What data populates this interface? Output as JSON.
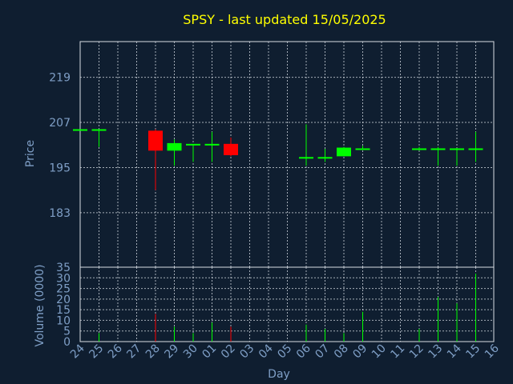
{
  "chart_data": {
    "type": "candlestick",
    "title": "SPSY - last updated 15/05/2025",
    "xlabel": "Day",
    "price_panel": {
      "ylabel": "Price",
      "ylim": [
        168.5,
        228.5
      ],
      "yticks": [
        183,
        195,
        207,
        219
      ]
    },
    "volume_panel": {
      "ylabel": "Volume (0000)",
      "ylim": [
        0,
        35
      ],
      "yticks": [
        0,
        5,
        10,
        15,
        20,
        25,
        30,
        35
      ]
    },
    "x_ticks": [
      "24",
      "25",
      "26",
      "27",
      "28",
      "29",
      "30",
      "01",
      "02",
      "03",
      "04",
      "05",
      "06",
      "07",
      "08",
      "09",
      "10",
      "11",
      "12",
      "13",
      "14",
      "15",
      "16"
    ],
    "up_color": "#00ff00",
    "down_color": "#ff0000",
    "candles": [
      {
        "day": "24",
        "open": 205,
        "high": 205,
        "low": 205,
        "close": 205.2,
        "volume": 0
      },
      {
        "day": "25",
        "open": 205,
        "high": 205,
        "low": 200.5,
        "close": 205.2,
        "volume": 4
      },
      {
        "day": "28",
        "open": 204.8,
        "high": 205.2,
        "low": 189,
        "close": 199.5,
        "volume": 13
      },
      {
        "day": "29",
        "open": 199.5,
        "high": 202.5,
        "low": 195.5,
        "close": 201.5,
        "volume": 7
      },
      {
        "day": "30",
        "open": 201,
        "high": 201,
        "low": 196.5,
        "close": 201.3,
        "volume": 4
      },
      {
        "day": "01",
        "open": 201,
        "high": 204.5,
        "low": 196.5,
        "close": 201.3,
        "volume": 9
      },
      {
        "day": "02",
        "open": 201.3,
        "high": 203,
        "low": 198,
        "close": 198.3,
        "volume": 7
      },
      {
        "day": "06",
        "open": 197.5,
        "high": 206.5,
        "low": 195.5,
        "close": 197.8,
        "volume": 8
      },
      {
        "day": "07",
        "open": 197.5,
        "high": 200,
        "low": 196.5,
        "close": 197.8,
        "volume": 6
      },
      {
        "day": "08",
        "open": 198,
        "high": 200.5,
        "low": 198,
        "close": 200.3,
        "volume": 4
      },
      {
        "day": "09",
        "open": 199.8,
        "high": 200.8,
        "low": 199.8,
        "close": 200.1,
        "volume": 14
      },
      {
        "day": "12",
        "open": 199.8,
        "high": 200.5,
        "low": 199.5,
        "close": 200.1,
        "volume": 6
      },
      {
        "day": "13",
        "open": 199.8,
        "high": 200.5,
        "low": 195.5,
        "close": 200.1,
        "volume": 21
      },
      {
        "day": "14",
        "open": 199.8,
        "high": 200.2,
        "low": 195.5,
        "close": 200.1,
        "volume": 18
      },
      {
        "day": "15",
        "open": 199.8,
        "high": 204.5,
        "low": 196.5,
        "close": 200.1,
        "volume": 32
      }
    ]
  }
}
